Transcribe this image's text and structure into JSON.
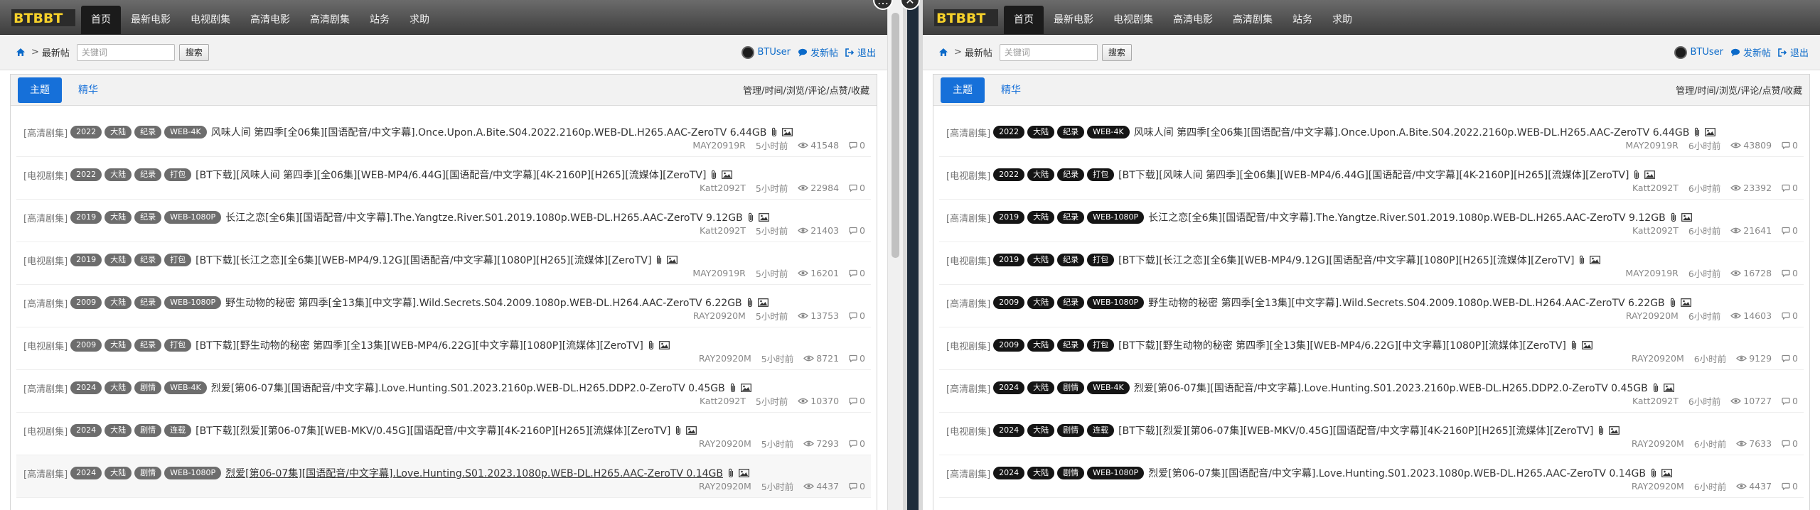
{
  "nav": {
    "logo_text": "BTBBT",
    "items": [
      "首页",
      "最新电影",
      "电视剧集",
      "高清电影",
      "高清剧集",
      "站务",
      "求助"
    ]
  },
  "breadcrumb": {
    "sep": ">",
    "current": "最新帖"
  },
  "search": {
    "placeholder": "关键词",
    "button": "搜索"
  },
  "user": {
    "name": "BTUser",
    "post_label": "发新帖",
    "logout_label": "退出"
  },
  "tabs": [
    "主题",
    "精华"
  ],
  "sort_links": "管理/时间/浏览/评论/点赞/收藏",
  "overlay": {
    "expand": "…",
    "close": "✕"
  },
  "threads": [
    {
      "cat": "[高清剧集]",
      "tags": [
        "2022",
        "大陆",
        "纪录",
        "WEB-4K"
      ],
      "title": "风味人间 第四季[全06集][国语配音/中文字幕].Once.Upon.A.Bite.S04.2022.2160p.WEB-DL.H265.AAC-ZeroTV 6.44GB",
      "user": "MAY20919R"
    },
    {
      "cat": "[电视剧集]",
      "tags": [
        "2022",
        "大陆",
        "纪录",
        "打包"
      ],
      "title": "[BT下载][风味人间 第四季][全06集][WEB-MP4/6.44G][国语配音/中文字幕][4K-2160P][H265][流媒体][ZeroTV]",
      "user": "Katt2092T"
    },
    {
      "cat": "[高清剧集]",
      "tags": [
        "2019",
        "大陆",
        "纪录",
        "WEB-1080P"
      ],
      "title": "长江之恋[全6集][国语配音/中文字幕].The.Yangtze.River.S01.2019.1080p.WEB-DL.H265.AAC-ZeroTV 9.12GB",
      "user": "Katt2092T"
    },
    {
      "cat": "[电视剧集]",
      "tags": [
        "2019",
        "大陆",
        "纪录",
        "打包"
      ],
      "title": "[BT下载][长江之恋][全6集][WEB-MP4/9.12G][国语配音/中文字幕][1080P][H265][流媒体][ZeroTV]",
      "user": "MAY20919R"
    },
    {
      "cat": "[高清剧集]",
      "tags": [
        "2009",
        "大陆",
        "纪录",
        "WEB-1080P"
      ],
      "title": "野生动物的秘密 第四季[全13集][中文字幕].Wild.Secrets.S04.2009.1080p.WEB-DL.H264.AAC-ZeroTV 6.22GB",
      "user": "RAY20920M"
    },
    {
      "cat": "[电视剧集]",
      "tags": [
        "2009",
        "大陆",
        "纪录",
        "打包"
      ],
      "title": "[BT下载][野生动物的秘密 第四季][全13集][WEB-MP4/6.22G][中文字幕][1080P][流媒体][ZeroTV]",
      "user": "RAY20920M"
    },
    {
      "cat": "[高清剧集]",
      "tags": [
        "2024",
        "大陆",
        "剧情",
        "WEB-4K"
      ],
      "title": "烈爱[第06-07集][国语配音/中文字幕].Love.Hunting.S01.2023.2160p.WEB-DL.H265.DDP2.0-ZeroTV 0.45GB",
      "user": "Katt2092T"
    },
    {
      "cat": "[电视剧集]",
      "tags": [
        "2024",
        "大陆",
        "剧情",
        "连载"
      ],
      "title": "[BT下载][烈爱][第06-07集][WEB-MKV/0.45G][国语配音/中文字幕][4K-2160P][H265][流媒体][ZeroTV]",
      "user": "RAY20920M"
    },
    {
      "cat": "[高清剧集]",
      "tags": [
        "2024",
        "大陆",
        "剧情",
        "WEB-1080P"
      ],
      "title": "烈爱[第06-07集][国语配音/中文字幕].Love.Hunting.S01.2023.1080p.WEB-DL.H265.AAC-ZeroTV 0.14GB",
      "user": "RAY20920M"
    }
  ],
  "left_pane": {
    "time": "5小时前",
    "views": [
      "41548",
      "22984",
      "21403",
      "16201",
      "13753",
      "8721",
      "10370",
      "7293",
      "4437"
    ],
    "comments": [
      "0",
      "0",
      "0",
      "0",
      "0",
      "0",
      "0",
      "0",
      "0"
    ],
    "hovered_index": 8
  },
  "right_pane": {
    "time": "6小时前",
    "views": [
      "43809",
      "23392",
      "21641",
      "16728",
      "14603",
      "9129",
      "10727",
      "7633",
      "4437"
    ],
    "comments": [
      "0",
      "0",
      "0",
      "0",
      "0",
      "0",
      "0",
      "0",
      "0"
    ]
  },
  "colors": {
    "accent": "#1670d9",
    "nav_bg": "#4a4a4a",
    "divider": "#1d2b3a"
  }
}
